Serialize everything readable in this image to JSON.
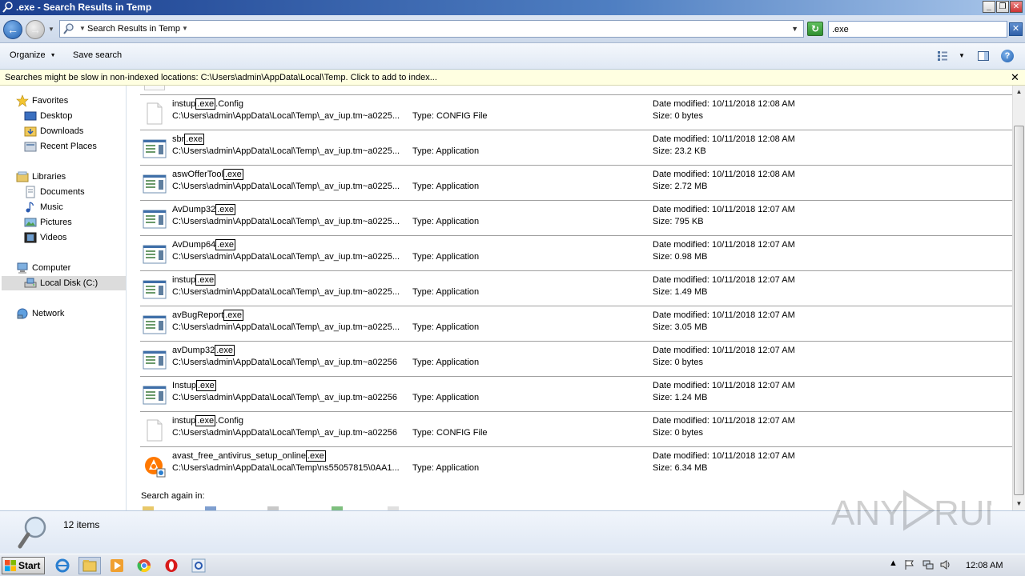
{
  "window": {
    "title": ".exe - Search Results in Temp",
    "buttons": {
      "minimize": "_",
      "maximize": "❐",
      "close": "✕"
    }
  },
  "address": {
    "location": "Search Results in Temp",
    "search_query": ".exe"
  },
  "toolbar": {
    "organize_label": "Organize",
    "save_search_label": "Save search"
  },
  "infobar": {
    "message": "Searches might be slow in non-indexed locations: C:\\Users\\admin\\AppData\\Local\\Temp. Click to add to index..."
  },
  "nav": {
    "favorites": {
      "label": "Favorites",
      "items": [
        "Desktop",
        "Downloads",
        "Recent Places"
      ]
    },
    "libraries": {
      "label": "Libraries",
      "items": [
        "Documents",
        "Music",
        "Pictures",
        "Videos"
      ]
    },
    "computer": {
      "label": "Computer",
      "items": [
        "Local Disk (C:)"
      ]
    },
    "network": {
      "label": "Network"
    }
  },
  "results": [
    {
      "name_pre": "instup",
      "name_hl": ".exe",
      "name_post": ".Config",
      "path": "C:\\Users\\admin\\AppData\\Local\\Temp\\_av_iup.tm~a0225...",
      "type": "Type: CONFIG File",
      "date": "Date modified: 10/11/2018 12:08 AM",
      "size": "Size: 0 bytes",
      "icon": "config-file-icon"
    },
    {
      "name_pre": "sbr",
      "name_hl": ".exe",
      "name_post": "",
      "path": "C:\\Users\\admin\\AppData\\Local\\Temp\\_av_iup.tm~a0225...",
      "type": "Type: Application",
      "date": "Date modified: 10/11/2018 12:08 AM",
      "size": "Size: 23.2 KB",
      "icon": "application-icon"
    },
    {
      "name_pre": "aswOfferTool",
      "name_hl": ".exe",
      "name_post": "",
      "path": "C:\\Users\\admin\\AppData\\Local\\Temp\\_av_iup.tm~a0225...",
      "type": "Type: Application",
      "date": "Date modified: 10/11/2018 12:08 AM",
      "size": "Size: 2.72 MB",
      "icon": "application-icon"
    },
    {
      "name_pre": "AvDump32",
      "name_hl": ".exe",
      "name_post": "",
      "path": "C:\\Users\\admin\\AppData\\Local\\Temp\\_av_iup.tm~a0225...",
      "type": "Type: Application",
      "date": "Date modified: 10/11/2018 12:07 AM",
      "size": "Size: 795 KB",
      "icon": "application-icon"
    },
    {
      "name_pre": "AvDump64",
      "name_hl": ".exe",
      "name_post": "",
      "path": "C:\\Users\\admin\\AppData\\Local\\Temp\\_av_iup.tm~a0225...",
      "type": "Type: Application",
      "date": "Date modified: 10/11/2018 12:07 AM",
      "size": "Size: 0.98 MB",
      "icon": "application-icon"
    },
    {
      "name_pre": "instup",
      "name_hl": ".exe",
      "name_post": "",
      "path": "C:\\Users\\admin\\AppData\\Local\\Temp\\_av_iup.tm~a0225...",
      "type": "Type: Application",
      "date": "Date modified: 10/11/2018 12:07 AM",
      "size": "Size: 1.49 MB",
      "icon": "application-icon"
    },
    {
      "name_pre": "avBugReport",
      "name_hl": ".exe",
      "name_post": "",
      "path": "C:\\Users\\admin\\AppData\\Local\\Temp\\_av_iup.tm~a0225...",
      "type": "Type: Application",
      "date": "Date modified: 10/11/2018 12:07 AM",
      "size": "Size: 3.05 MB",
      "icon": "application-icon"
    },
    {
      "name_pre": "avDump32",
      "name_hl": ".exe",
      "name_post": "",
      "path": "C:\\Users\\admin\\AppData\\Local\\Temp\\_av_iup.tm~a02256",
      "type": "Type: Application",
      "date": "Date modified: 10/11/2018 12:07 AM",
      "size": "Size: 0 bytes",
      "icon": "application-icon"
    },
    {
      "name_pre": "Instup",
      "name_hl": ".exe",
      "name_post": "",
      "path": "C:\\Users\\admin\\AppData\\Local\\Temp\\_av_iup.tm~a02256",
      "type": "Type: Application",
      "date": "Date modified: 10/11/2018 12:07 AM",
      "size": "Size: 1.24 MB",
      "icon": "application-icon"
    },
    {
      "name_pre": "instup",
      "name_hl": ".exe",
      "name_post": ".Config",
      "path": "C:\\Users\\admin\\AppData\\Local\\Temp\\_av_iup.tm~a02256",
      "type": "Type: CONFIG File",
      "date": "Date modified: 10/11/2018 12:07 AM",
      "size": "Size: 0 bytes",
      "icon": "config-file-icon"
    },
    {
      "name_pre": "avast_free_antivirus_setup_online",
      "name_hl": ".exe",
      "name_post": "",
      "path": "C:\\Users\\admin\\AppData\\Local\\Temp\\ns55057815\\0AA1...",
      "type": "Type: Application",
      "date": "Date modified: 10/11/2018 12:07 AM",
      "size": "Size: 6.34 MB",
      "icon": "avast-icon"
    }
  ],
  "search_again_label": "Search again in:",
  "details": {
    "count": "12 items"
  },
  "taskbar": {
    "start_label": "Start",
    "clock": "12:08 AM"
  },
  "colors": {
    "title_gradient_start": "#1b3f8f",
    "infobar_bg": "#ffffe1",
    "selection_bg": "#dcdcdc"
  }
}
